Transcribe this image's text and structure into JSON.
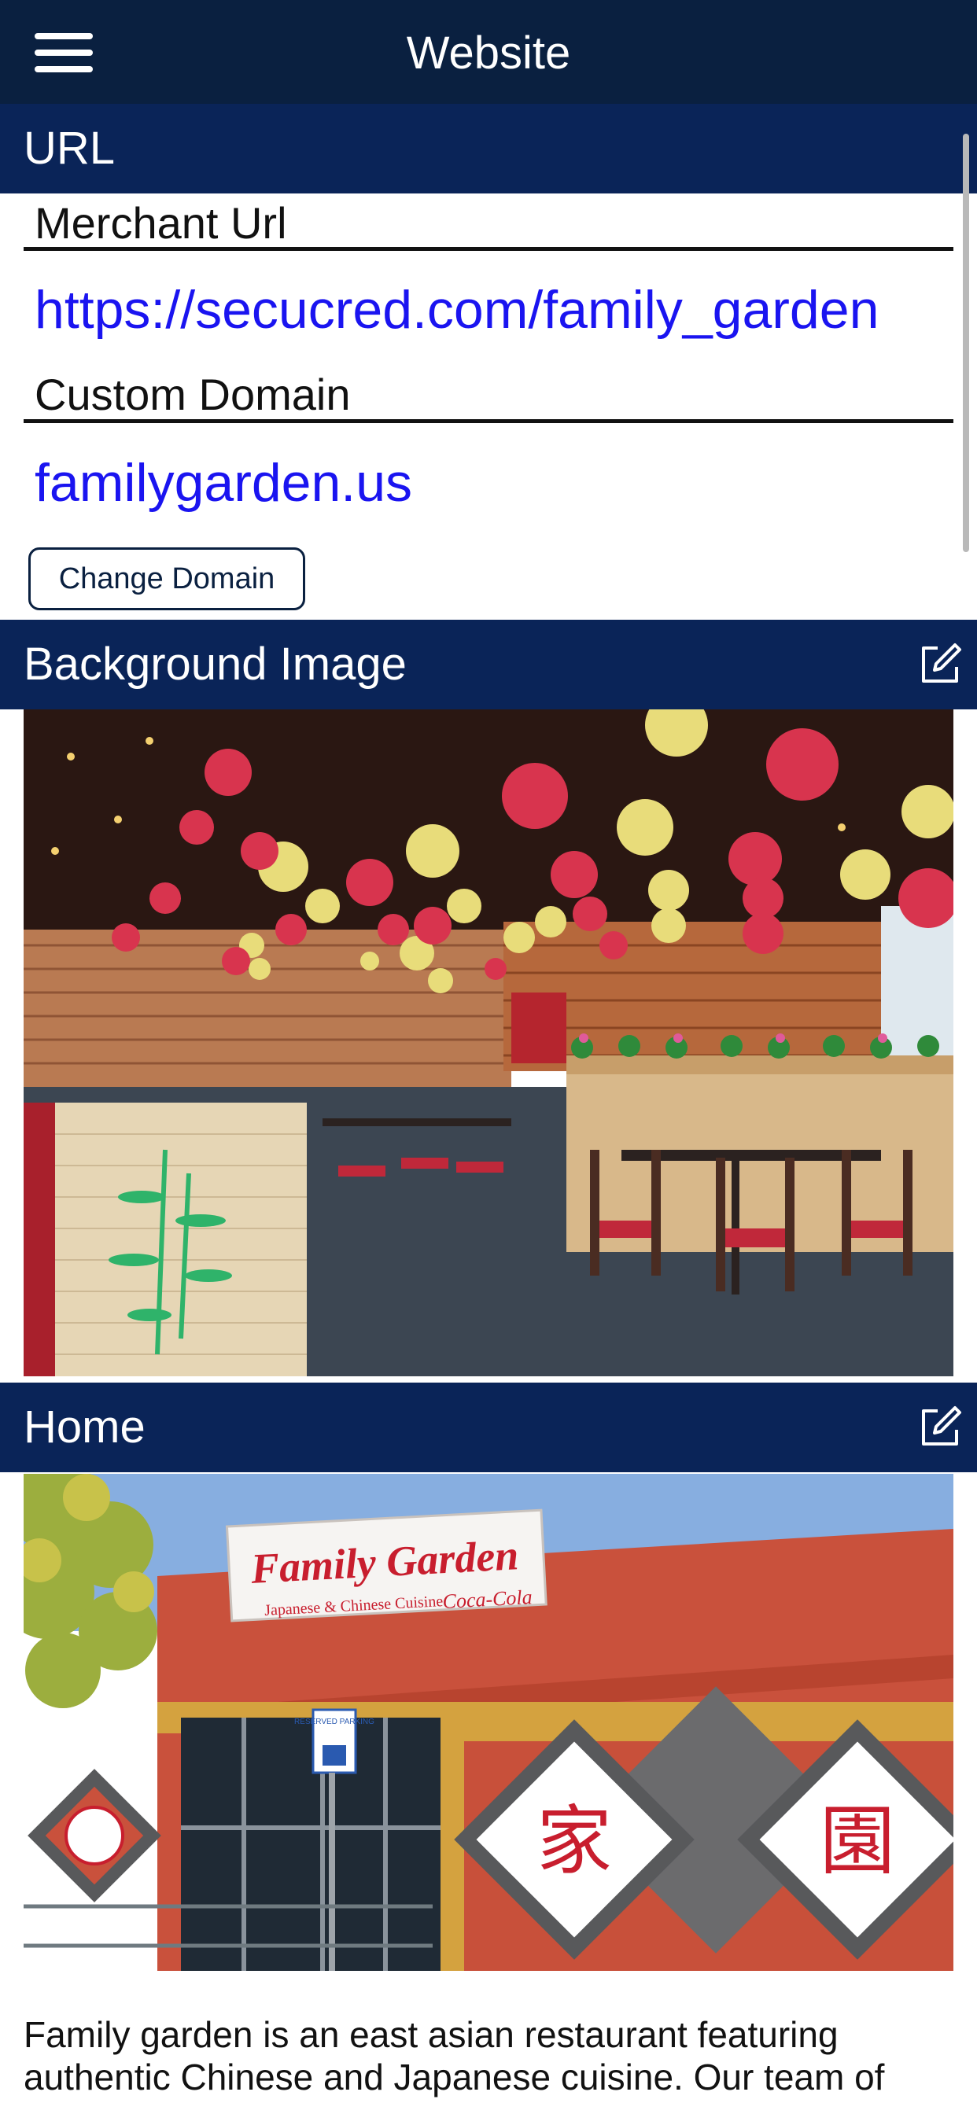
{
  "topbar": {
    "title": "Website",
    "menu_icon": "hamburger-menu-icon"
  },
  "url_section": {
    "header": "URL",
    "merchant_url_label": "Merchant Url",
    "merchant_url": "https://secucred.com/family_garden",
    "custom_domain_label": "Custom Domain",
    "custom_domain": "familygarden.us",
    "change_domain_button": "Change Domain"
  },
  "background_section": {
    "header": "Background Image",
    "edit_icon": "edit-square-icon"
  },
  "home_section": {
    "header": "Home",
    "edit_icon": "edit-square-icon",
    "sign_title": "Family Garden",
    "sign_subtitle": "Japanese & Chinese Cuisine",
    "sign_brand": "Coca-Cola",
    "parking_sign": "RESERVED PARKING",
    "char_left": "家",
    "char_right": "園",
    "description": "Family garden is an east asian restaurant featuring authentic Chinese and Japanese cuisine. Our team of"
  },
  "colors": {
    "topbar": "#0a2040",
    "section_header": "#0a2458",
    "link": "#1a14f0"
  }
}
